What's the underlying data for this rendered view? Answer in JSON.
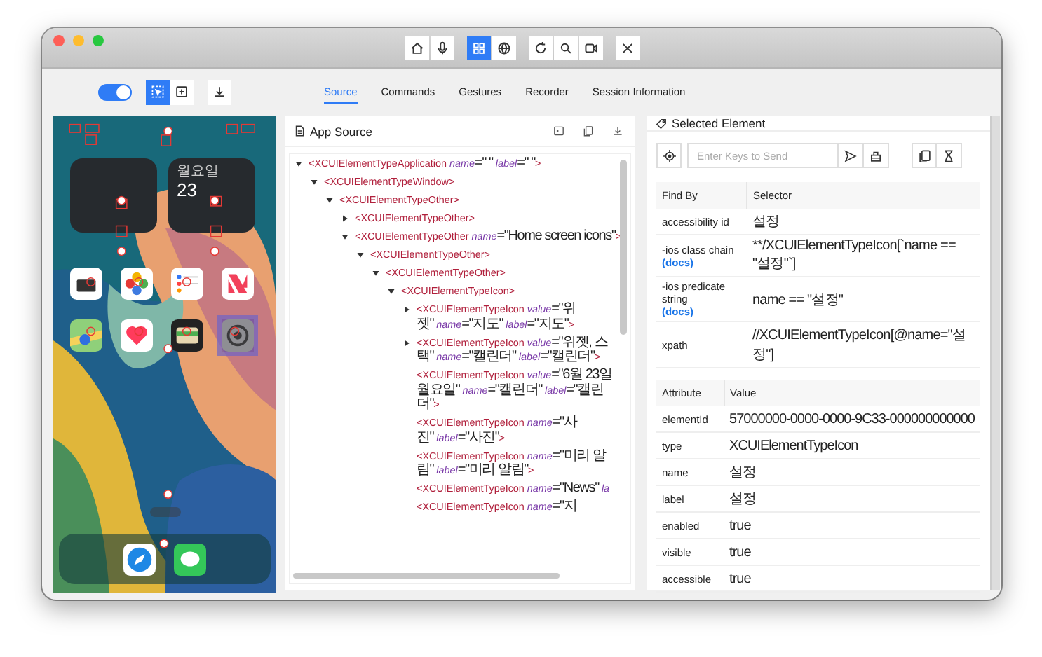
{
  "window_toolbar": {
    "groups": [
      [
        {
          "kind": "home",
          "selected": false
        },
        {
          "kind": "mic",
          "selected": false
        }
      ],
      [
        {
          "kind": "grid",
          "selected": true
        },
        {
          "kind": "globe",
          "selected": false
        }
      ],
      [
        {
          "kind": "refresh",
          "selected": false
        },
        {
          "kind": "search",
          "selected": false
        },
        {
          "kind": "video",
          "selected": false
        }
      ],
      [
        {
          "kind": "close",
          "selected": false
        }
      ]
    ]
  },
  "controls": {
    "toggle_on": true,
    "modes": [
      {
        "kind": "select",
        "selected": true
      },
      {
        "kind": "tap",
        "selected": false
      }
    ]
  },
  "tabs": [
    {
      "label": "Source",
      "selected": true
    },
    {
      "label": "Commands",
      "selected": false
    },
    {
      "label": "Gestures",
      "selected": false
    },
    {
      "label": "Recorder",
      "selected": false
    },
    {
      "label": "Session Information",
      "selected": false
    }
  ],
  "device_screen": {
    "widgets": [
      {
        "kind": "blank"
      },
      {
        "kind": "calendar",
        "day": "월요일",
        "date": "23"
      }
    ],
    "apps": [
      {
        "kind": "calendar",
        "selected": false
      },
      {
        "kind": "photos",
        "selected": false
      },
      {
        "kind": "reminders",
        "selected": false
      },
      {
        "kind": "news",
        "selected": false
      },
      {
        "kind": "maps",
        "selected": false
      },
      {
        "kind": "health",
        "selected": false
      },
      {
        "kind": "wallet",
        "selected": false
      },
      {
        "kind": "settings",
        "selected": true
      }
    ],
    "dock": [
      {
        "kind": "safari"
      },
      {
        "kind": "messages"
      }
    ]
  },
  "app_source": {
    "title": "App Source",
    "tree": [
      {
        "kind": "branch",
        "expanded": true,
        "tag": "<XCUIElementTypeApplication",
        "attrs": [
          {
            "name": "name",
            "value": "=\" \""
          },
          {
            "name": "label",
            "value": "=\" \""
          }
        ],
        "close": ">",
        "children": [
          {
            "kind": "branch",
            "expanded": true,
            "tag": "<XCUIElementTypeWindow",
            "close": ">",
            "children": [
              {
                "kind": "branch",
                "expanded": true,
                "tag": "<XCUIElementTypeOther",
                "close": ">",
                "children": [
                  {
                    "kind": "branch",
                    "expanded": false,
                    "tag": "<XCUIElementTypeOther",
                    "close": ">"
                  },
                  {
                    "kind": "branch",
                    "expanded": true,
                    "tag": "<XCUIElementTypeOther",
                    "attrs": [
                      {
                        "name": "name",
                        "value": "=\"Home screen icons\""
                      }
                    ],
                    "close": ">",
                    "children": [
                      {
                        "kind": "branch",
                        "expanded": true,
                        "tag": "<XCUIElementTypeOther",
                        "close": ">",
                        "children": [
                          {
                            "kind": "branch",
                            "expanded": true,
                            "tag": "<XCUIElementTypeOther",
                            "close": ">",
                            "children": [
                              {
                                "kind": "branch",
                                "expanded": true,
                                "tag": "<XCUIElementTypeIcon",
                                "close": ">",
                                "children": [
                                  {
                                    "kind": "branch",
                                    "expanded": false,
                                    "tag": "<XCUIElementTypeIcon",
                                    "attrs": [
                                      {
                                        "name": "value",
                                        "value": "=\"위젯\""
                                      },
                                      {
                                        "name": "name",
                                        "value": "=\"지도\""
                                      },
                                      {
                                        "name": "label",
                                        "value": "=\"지도\""
                                      }
                                    ],
                                    "close": ">"
                                  },
                                  {
                                    "kind": "branch",
                                    "expanded": false,
                                    "tag": "<XCUIElementTypeIcon",
                                    "attrs": [
                                      {
                                        "name": "value",
                                        "value": "=\"위젯, 스택\""
                                      },
                                      {
                                        "name": "name",
                                        "value": "=\"캘린더\""
                                      },
                                      {
                                        "name": "label",
                                        "value": "=\"캘린더\""
                                      }
                                    ],
                                    "close": ">"
                                  },
                                  {
                                    "kind": "leaf",
                                    "tag": "<XCUIElementTypeIcon",
                                    "attrs": [
                                      {
                                        "name": "value",
                                        "value": "=\"6월 23일 월요일\""
                                      },
                                      {
                                        "name": "name",
                                        "value": "=\"캘린더\""
                                      },
                                      {
                                        "name": "label",
                                        "value": "=\"캘린더\""
                                      }
                                    ],
                                    "close": ">"
                                  },
                                  {
                                    "kind": "leaf",
                                    "tag": "<XCUIElementTypeIcon",
                                    "attrs": [
                                      {
                                        "name": "name",
                                        "value": "=\"사진\""
                                      },
                                      {
                                        "name": "label",
                                        "value": "=\"사진\""
                                      }
                                    ],
                                    "close": ">"
                                  },
                                  {
                                    "kind": "leaf",
                                    "tag": "<XCUIElementTypeIcon",
                                    "attrs": [
                                      {
                                        "name": "name",
                                        "value": "=\"미리 알림\""
                                      },
                                      {
                                        "name": "label",
                                        "value": "=\"미리 알림\""
                                      }
                                    ],
                                    "close": ">"
                                  },
                                  {
                                    "kind": "leaf",
                                    "tag": "<XCUIElementTypeIcon",
                                    "attrs": [
                                      {
                                        "name": "name",
                                        "value": "=\"News\""
                                      },
                                      {
                                        "name": "la"
                                      }
                                    ]
                                  },
                                  {
                                    "kind": "leaf",
                                    "tag": "<XCUIElementTypeIcon",
                                    "attrs": [
                                      {
                                        "name": "name",
                                        "value": "=\"지"
                                      }
                                    ]
                                  }
                                ]
                              }
                            ]
                          }
                        ]
                      }
                    ]
                  }
                ]
              }
            ]
          }
        ]
      }
    ]
  },
  "selected_element": {
    "title": "Selected Element",
    "keys_placeholder": "Enter Keys to Send",
    "find_by": {
      "columns": [
        "Find By",
        "Selector"
      ],
      "rows": [
        {
          "strategy": "accessibility id",
          "selector": "설정"
        },
        {
          "strategy": "-ios class chain",
          "link": "(docs)",
          "selector": "**/XCUIElementTypeIcon[`name == \"설정\"`]"
        },
        {
          "strategy": "-ios predicate string",
          "link": "(docs)",
          "selector": "name == \"설정\""
        },
        {
          "strategy": "xpath",
          "selector": "//XCUIElementTypeIcon[@name=\"설정\"]"
        }
      ]
    },
    "attributes": {
      "columns": [
        "Attribute",
        "Value"
      ],
      "rows": [
        {
          "name": "elementId",
          "value": "57000000-0000-0000-9C33-000000000000"
        },
        {
          "name": "type",
          "value": "XCUIElementTypeIcon"
        },
        {
          "name": "name",
          "value": "설정"
        },
        {
          "name": "label",
          "value": "설정"
        },
        {
          "name": "enabled",
          "value": "true"
        },
        {
          "name": "visible",
          "value": "true"
        },
        {
          "name": "accessible",
          "value": "true"
        }
      ]
    }
  }
}
